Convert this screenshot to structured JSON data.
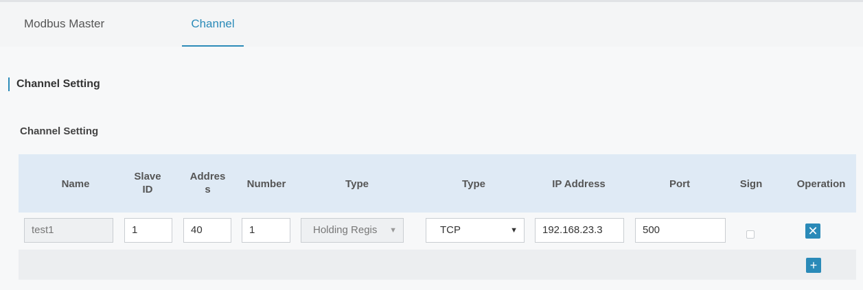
{
  "tabs": [
    {
      "label": "Modbus Master",
      "active": false
    },
    {
      "label": "Channel",
      "active": true
    }
  ],
  "section_title": "Channel Setting",
  "sub_title": "Channel Setting",
  "table": {
    "headers": {
      "name": "Name",
      "slave_id_line1": "Slave",
      "slave_id_line2": "ID",
      "address_line1": "Addres",
      "address_line2": "s",
      "number": "Number",
      "type1": "Type",
      "type2": "Type",
      "ip": "IP Address",
      "port": "Port",
      "sign": "Sign",
      "operation": "Operation"
    },
    "row": {
      "name": "test1",
      "slave_id": "1",
      "address": "40",
      "number": "1",
      "reg_type": "Holding Regis",
      "proto_type": "TCP",
      "ip": "192.168.23.3",
      "port": "500",
      "sign_checked": false
    }
  },
  "icons": {
    "dropdown": "▼",
    "delete": "✕",
    "add": "+"
  },
  "colors": {
    "accent": "#2a8ab8",
    "header_bg": "#dfeaf5"
  }
}
